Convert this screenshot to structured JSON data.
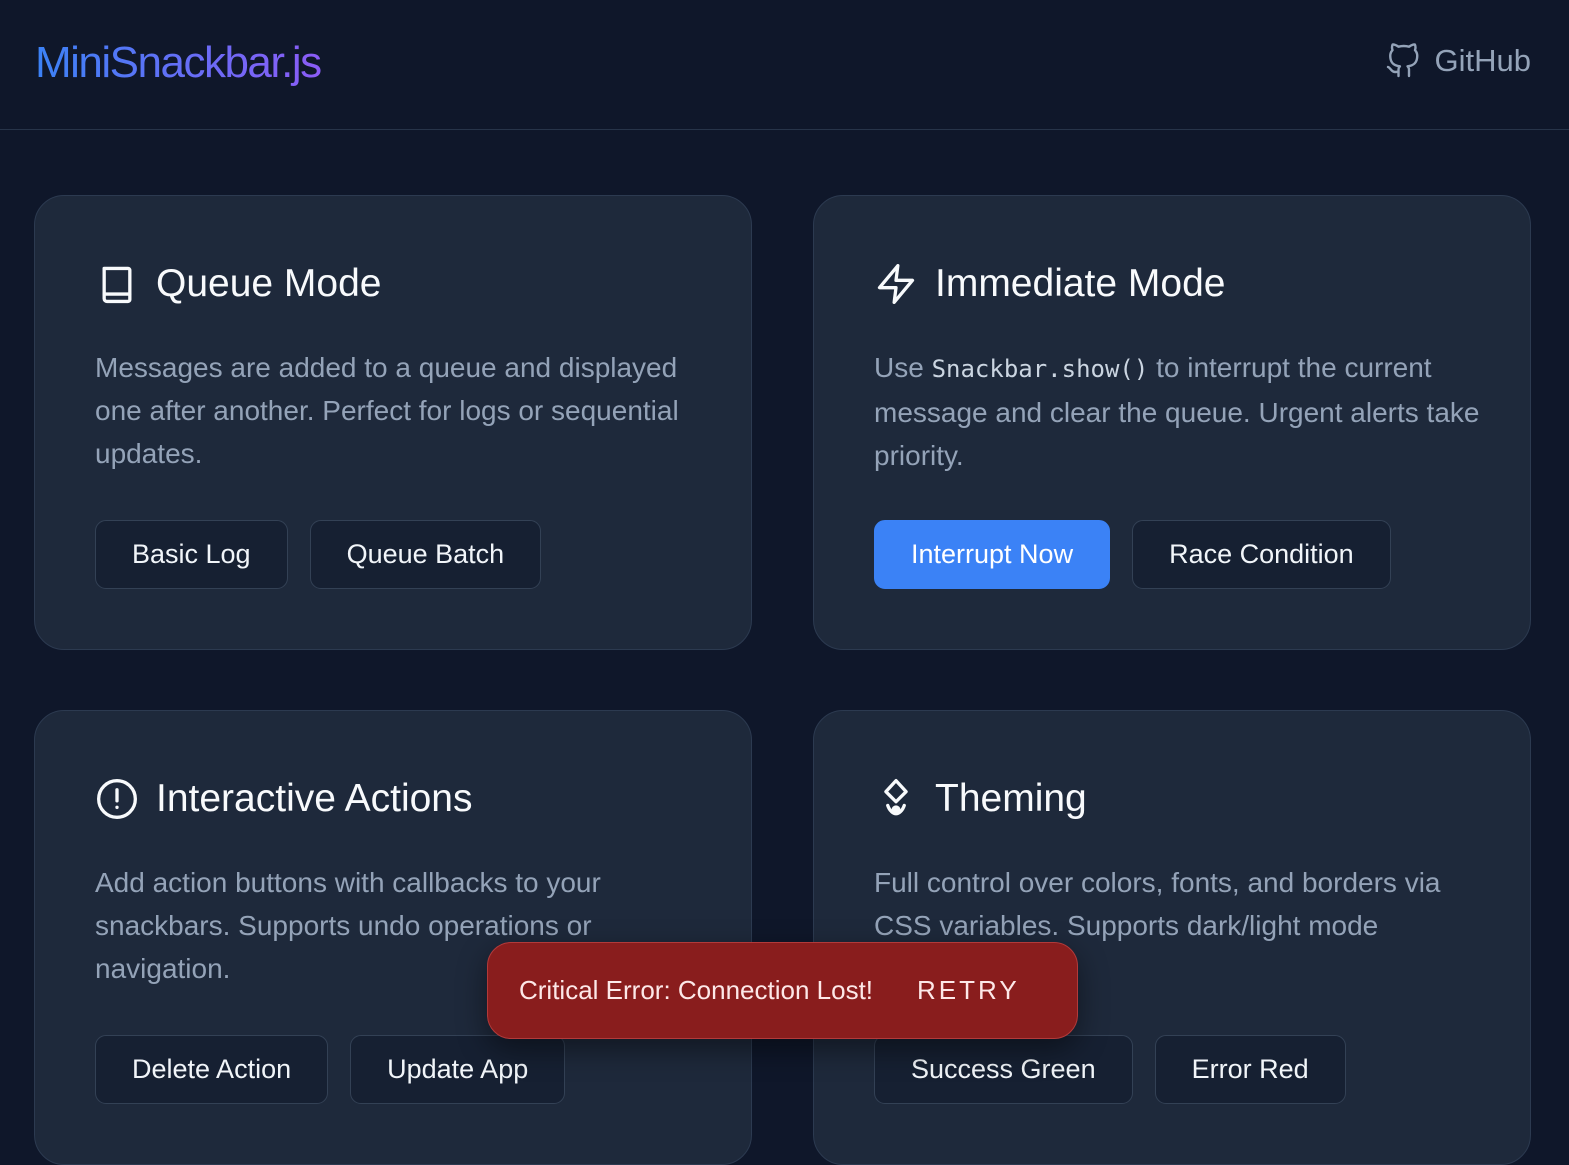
{
  "header": {
    "logo": "MiniSnackbar.js",
    "github_label": "GitHub",
    "github_icon": "github-icon"
  },
  "cards": [
    {
      "title": "Queue Mode",
      "icon": "book-icon",
      "description": "Messages are added to a queue and displayed one after another. Perfect for logs or sequential updates.",
      "buttons": [
        "Basic Log",
        "Queue Batch"
      ]
    },
    {
      "title": "Immediate Mode",
      "icon": "lightning-icon",
      "description_prefix": "Use ",
      "description_code": "Snackbar.show()",
      "description_suffix": " to interrupt the current message and clear the queue. Urgent alerts take priority.",
      "buttons": [
        "Interrupt Now",
        "Race Condition"
      ]
    },
    {
      "title": "Interactive Actions",
      "icon": "alert-circle-icon",
      "description": "Add action buttons with callbacks to your snackbars. Supports undo operations or navigation.",
      "buttons": [
        "Delete Action",
        "Update App"
      ]
    },
    {
      "title": "Theming",
      "icon": "droplet-theme-icon",
      "description": "Full control over colors, fonts, and borders via CSS variables. Supports dark/light mode",
      "buttons": [
        "Success Green",
        "Error Red"
      ]
    }
  ],
  "snackbar": {
    "message": "Critical Error: Connection Lost!",
    "action": "RETRY",
    "color": "#891d1d"
  },
  "colors": {
    "background": "#0f172a",
    "card": "#1e293b",
    "primary": "#3b82f6",
    "logo_gradient_start": "#3b82f6",
    "logo_gradient_end": "#8b5cf6"
  }
}
